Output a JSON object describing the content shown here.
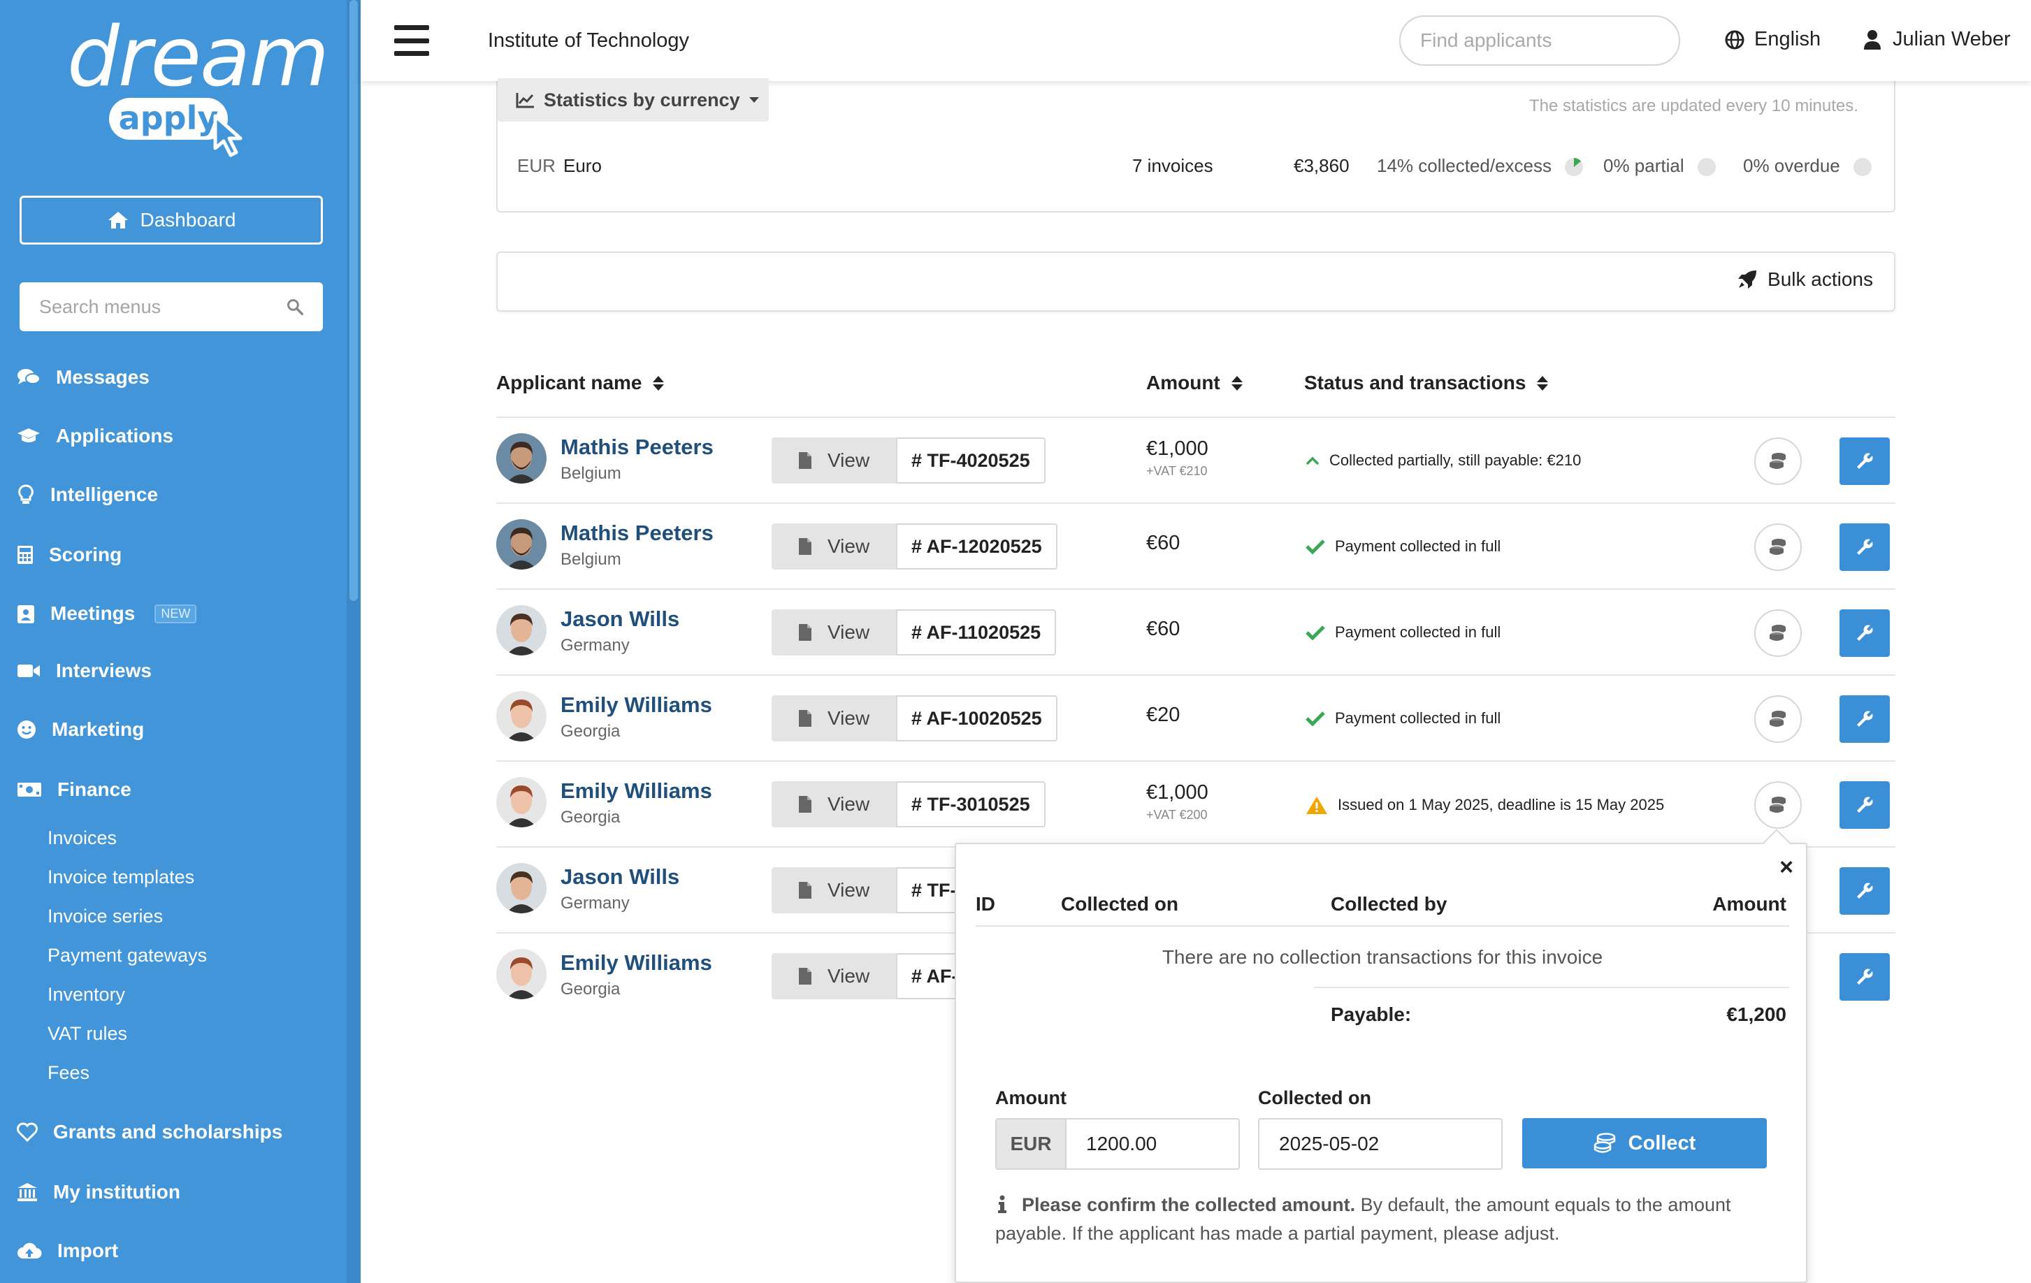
{
  "brand": {
    "word1": "dream",
    "word2": "apply"
  },
  "sidebar": {
    "dashboard_label": "Dashboard",
    "search_placeholder": "Search menus",
    "items": [
      {
        "label": "Messages",
        "icon": "comments-icon"
      },
      {
        "label": "Applications",
        "icon": "graduation-cap-icon"
      },
      {
        "label": "Intelligence",
        "icon": "lightbulb-icon"
      },
      {
        "label": "Scoring",
        "icon": "calculator-icon"
      },
      {
        "label": "Meetings",
        "icon": "calendar-user-icon",
        "badge": "NEW"
      },
      {
        "label": "Interviews",
        "icon": "video-icon"
      },
      {
        "label": "Marketing",
        "icon": "smile-icon"
      },
      {
        "label": "Finance",
        "icon": "money-bill-icon"
      },
      {
        "label": "Grants and scholarships",
        "icon": "heart-icon"
      },
      {
        "label": "My institution",
        "icon": "institution-icon"
      },
      {
        "label": "Import",
        "icon": "cloud-upload-icon"
      }
    ],
    "finance_sub": [
      "Invoices",
      "Invoice templates",
      "Invoice series",
      "Payment gateways",
      "Inventory",
      "VAT rules",
      "Fees"
    ]
  },
  "header": {
    "institution": "Institute of Technology",
    "find_placeholder": "Find applicants",
    "language": "English",
    "user": "Julian Weber"
  },
  "stats": {
    "tab_label": "Statistics by currency",
    "note": "The statistics are updated every 10 minutes.",
    "currency_code": "EUR",
    "currency_name": "Euro",
    "invoices": "7 invoices",
    "total": "€3,860",
    "collected": "14% collected/excess",
    "collected_fraction": 0.14,
    "partial": "0% partial",
    "overdue": "0% overdue"
  },
  "bulk_actions_label": "Bulk actions",
  "table": {
    "headers": {
      "name": "Applicant name",
      "amount": "Amount",
      "status": "Status and transactions"
    },
    "view_label": "View",
    "rows": [
      {
        "name": "Mathis Peeters",
        "country": "Belgium",
        "invoice": "# TF-4020525",
        "amount": "€1,000",
        "vat": "+VAT €210",
        "status": "Collected partially, still payable: €210",
        "status_icon": "chevron-up-icon"
      },
      {
        "name": "Mathis Peeters",
        "country": "Belgium",
        "invoice": "# AF-12020525",
        "amount": "€60",
        "vat": "",
        "status": "Payment collected in full",
        "status_icon": "check-icon"
      },
      {
        "name": "Jason Wills",
        "country": "Germany",
        "invoice": "# AF-11020525",
        "amount": "€60",
        "vat": "",
        "status": "Payment collected in full",
        "status_icon": "check-icon"
      },
      {
        "name": "Emily Williams",
        "country": "Georgia",
        "invoice": "# AF-10020525",
        "amount": "€20",
        "vat": "",
        "status": "Payment collected in full",
        "status_icon": "check-icon"
      },
      {
        "name": "Emily Williams",
        "country": "Georgia",
        "invoice": "# TF-3010525",
        "amount": "€1,000",
        "vat": "+VAT €200",
        "status": "Issued on 1 May 2025, deadline is 15 May 2025",
        "status_icon": "warning-icon"
      },
      {
        "name": "Jason Wills",
        "country": "Germany",
        "invoice": "# TF-",
        "amount": "",
        "vat": "",
        "status": "",
        "status_icon": ""
      },
      {
        "name": "Emily Williams",
        "country": "Georgia",
        "invoice": "# AF-",
        "amount": "",
        "vat": "",
        "status": "",
        "status_icon": ""
      }
    ]
  },
  "popover": {
    "close": "×",
    "headers": {
      "id": "ID",
      "collected_on": "Collected on",
      "collected_by": "Collected by",
      "amount": "Amount"
    },
    "empty": "There are no collection transactions for this invoice",
    "payable_label": "Payable:",
    "payable_value": "€1,200",
    "form": {
      "amount_label": "Amount",
      "currency": "EUR",
      "amount_value": "1200.00",
      "date_label": "Collected on",
      "date_value": "2025-05-02",
      "collect_label": "Collect"
    },
    "note_bold": "Please confirm the collected amount.",
    "note_rest": " By default, the amount equals to the amount payable. If the applicant has made a partial payment, please adjust."
  },
  "colors": {
    "sidebar": "#4295d9",
    "primary_button": "#3a8fd6",
    "link": "#1f4f7a",
    "success": "#3aa853",
    "warning": "#f0a500"
  }
}
